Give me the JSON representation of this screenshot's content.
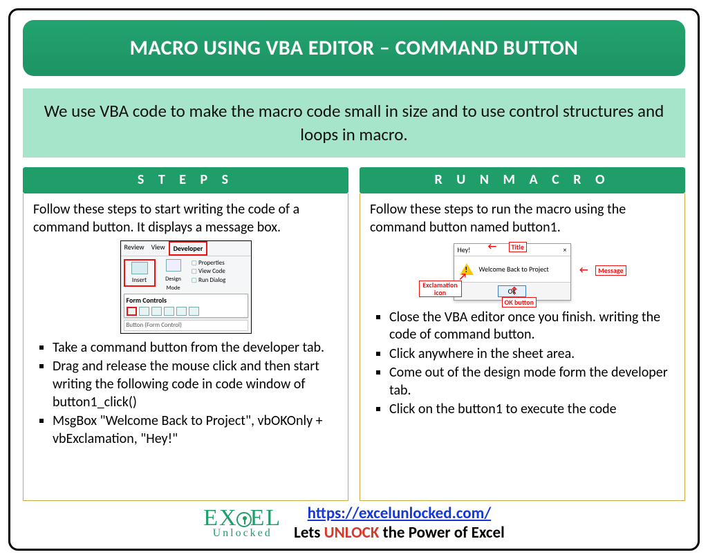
{
  "title": "MACRO USING VBA EDITOR – COMMAND BUTTON",
  "intro": "We use VBA code to make the macro code small in size and to use control structures and loops in macro.",
  "left": {
    "header": "S T E P S",
    "lead": "Follow these steps to start writing the code of a command button. It displays a message box.",
    "ribbon": {
      "tabs": [
        "Review",
        "View",
        "Developer"
      ],
      "insert_label": "Insert",
      "design_label": "Design Mode",
      "props": [
        "Properties",
        "View Code",
        "Run Dialog"
      ],
      "form_controls_label": "Form Controls",
      "tooltip": "Button (Form Control)"
    },
    "bullets": [
      "Take a command button from the developer tab.",
      "Drag and release the mouse click and then start writing the following code in code window of button1_click()",
      "MsgBox \"Welcome Back to Project\", vbOKOnly + vbExclamation, \"Hey!\""
    ]
  },
  "right": {
    "header": "R U N   M A C R O",
    "lead": "Follow these steps to run the macro using the command button named button1.",
    "msgbox": {
      "title_text": "Hey!",
      "close": "×",
      "message": "Welcome Back to Project",
      "ok": "OK",
      "ann_title": "Title",
      "ann_message": "Message",
      "ann_exclam": "Exclamation icon",
      "ann_ok": "OK button"
    },
    "bullets": [
      "Close the VBA editor once you finish. writing the code of command button.",
      "Click anywhere in the sheet area.",
      "Come out of the design mode form the developer tab.",
      "Click on the button1 to execute the code"
    ]
  },
  "footer": {
    "logo_top": "EX   EL",
    "logo_sub": "Unlocked",
    "url": "https://excelunlocked.com/",
    "tag_pre": "Lets ",
    "tag_unlock": "UNLOCK",
    "tag_post": " the Power of Excel"
  }
}
